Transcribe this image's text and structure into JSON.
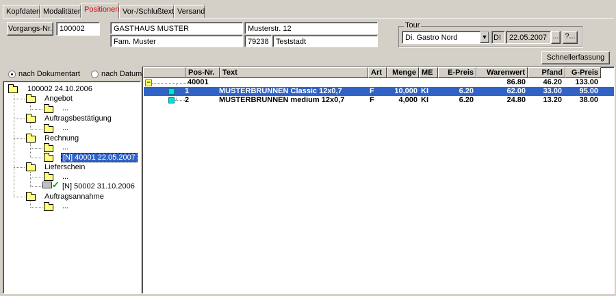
{
  "tabs": [
    {
      "label": "Kopfdaten"
    },
    {
      "label": "Modalitäten"
    },
    {
      "label": "Positionen",
      "active": true
    },
    {
      "label": "Vor-/Schlußtexte"
    },
    {
      "label": "Versand"
    }
  ],
  "header": {
    "vorgang_label": "Vorgangs-Nr.",
    "vorgang_value": "100002",
    "name1": "GASTHAUS MUSTER",
    "name2": "Fam. Muster",
    "street": "Musterstr. 12",
    "zip": "79238",
    "city": "Teststadt"
  },
  "tour": {
    "label": "Tour",
    "select": "Di. Gastro Nord",
    "day": "DI",
    "date": "22.05.2007",
    "dots_button": "...",
    "help_button": "?..."
  },
  "schnell_button": "Schnellerfassung",
  "radios": {
    "doc": "nach Dokumentart",
    "date": "nach Datum"
  },
  "tree": {
    "root": "100002 24.10.2006",
    "angebot": "Angebot",
    "angebot_child": "...",
    "auftragsbest": "Auftragsbestätigung",
    "auftragsbest_child": "...",
    "rechnung": "Rechnung",
    "rechnung_child1": "...",
    "rechnung_child2": "[N] 40001 22.05.2007",
    "lieferschein": "Lieferschein",
    "lieferschein_child1": "...",
    "lieferschein_child2": "[N] 50002 31.10.2006",
    "auftragsannahme": "Auftragsannahme",
    "auftragsannahme_child": "..."
  },
  "grid": {
    "headers": {
      "pos": "Pos-Nr.",
      "text": "Text",
      "art": "Art",
      "menge": "Menge",
      "me": "ME",
      "epreis": "E-Preis",
      "warenwert": "Warenwert",
      "pfand": "Pfand",
      "gpreis": "G-Preis"
    },
    "group": {
      "pos": "40001",
      "warenwert": "86.80",
      "pfand": "46.20",
      "gpreis": "133.00"
    },
    "rows": [
      {
        "pos": "1",
        "text": "MUSTERBRUNNEN Classic 12x0,7",
        "art": "F",
        "menge": "10,000",
        "me": "KI",
        "epreis": "6.20",
        "warenwert": "62.00",
        "pfand": "33.00",
        "gpreis": "95.00"
      },
      {
        "pos": "2",
        "text": "MUSTERBRUNNEN medium 12x0,7",
        "art": "F",
        "menge": "4,000",
        "me": "KI",
        "epreis": "6.20",
        "warenwert": "24.80",
        "pfand": "13.20",
        "gpreis": "38.00"
      }
    ]
  },
  "colors": {
    "selection": "#3163c6",
    "active_tab": "#cc0000",
    "face": "#d4d0c8"
  }
}
